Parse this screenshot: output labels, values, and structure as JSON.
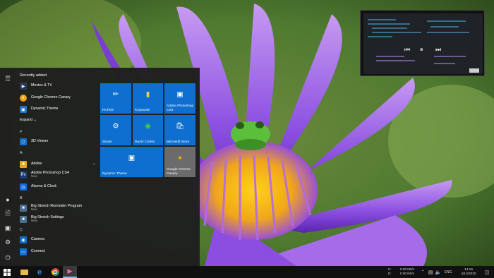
{
  "start_menu": {
    "recently_added_title": "Recently added",
    "expand_label": "Expand",
    "recent": [
      {
        "label": "Movies & TV",
        "icon": "film-icon",
        "color": "#2a3a55"
      },
      {
        "label": "Google Chrome Canary",
        "icon": "chrome-canary-icon",
        "color": "#f0a21b"
      },
      {
        "label": "Dynamic Theme",
        "icon": "dynamic-theme-icon",
        "color": "#1a73c9"
      }
    ],
    "groups": [
      {
        "letter": "#",
        "apps": [
          {
            "label": "3D Viewer",
            "sub": "",
            "icon": "cube-icon",
            "color": "#0e6fd0"
          }
        ]
      },
      {
        "letter": "A",
        "apps": [
          {
            "label": "Adobe",
            "sub": "",
            "icon": "folder-icon",
            "color": "#e0a52b",
            "expandable": true
          },
          {
            "label": "Adobe Photoshop CS4",
            "sub": "New",
            "icon": "photoshop-icon",
            "color": "#1c3d73"
          },
          {
            "label": "Alarms & Clock",
            "sub": "",
            "icon": "alarm-clock-icon",
            "color": "#0e6fd0"
          }
        ]
      },
      {
        "letter": "B",
        "apps": [
          {
            "label": "Big Stretch Reminder Program",
            "sub": "New",
            "icon": "stretch-icon",
            "color": "#4a6f8f"
          },
          {
            "label": "Big Stretch Settings",
            "sub": "New",
            "icon": "stretch-settings-icon",
            "color": "#4a6f8f"
          }
        ]
      },
      {
        "letter": "C",
        "apps": [
          {
            "label": "Camera",
            "sub": "",
            "icon": "camera-icon",
            "color": "#0e6fd0"
          },
          {
            "label": "Connect",
            "sub": "",
            "icon": "connect-icon",
            "color": "#0e6fd0"
          }
        ]
      }
    ],
    "tiles": [
      {
        "label": "PicPick",
        "icon": "picpick-icon",
        "color": "#0e6fd0"
      },
      {
        "label": "Keywords",
        "icon": "keywords-icon",
        "color": "#0e6fd0"
      },
      {
        "label": "Adobe Photoshop CS4",
        "icon": "photoshop-icon",
        "color": "#0e6fd0"
      },
      {
        "label": "Steam",
        "icon": "steam-icon",
        "color": "#0e6fd0"
      },
      {
        "label": "Razer Cortex",
        "icon": "razer-icon",
        "color": "#0e6fd0"
      },
      {
        "label": "Microsoft Store",
        "icon": "store-icon",
        "color": "#0e6fd0"
      },
      {
        "label": "Dynamic Theme",
        "icon": "dynamic-theme-icon",
        "color": "#0e6fd0"
      },
      {
        "label": "Google Chrome Canary",
        "icon": "chrome-canary-icon",
        "color": "#6b6b6b"
      }
    ]
  },
  "taskbar": {
    "tray_speed_up": "0.00 KB/s",
    "tray_speed_down": "0.00 KB/s",
    "tray_net_up_label": "U:",
    "tray_net_down_label": "D:",
    "language": "ENG",
    "time": "14:15",
    "date": "4/13/2020"
  }
}
